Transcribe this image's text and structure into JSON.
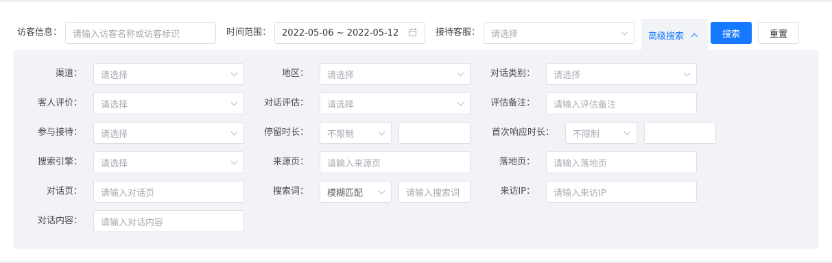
{
  "top": {
    "visitor_label": "访客信息：",
    "visitor_placeholder": "请输入访客名称或访客标识",
    "time_label": "时间范围：",
    "time_value": "2022-05-06 ~ 2022-05-12",
    "agent_label": "接待客服：",
    "agent_placeholder": "请选择",
    "advanced_label": "高级搜索",
    "search_button": "搜索",
    "reset_button": "重置"
  },
  "advanced": {
    "channel_label": "渠道：",
    "channel_placeholder": "请选择",
    "region_label": "地区：",
    "region_placeholder": "请选择",
    "category_label": "对话类别：",
    "category_placeholder": "请选择",
    "rating_label": "客人评价：",
    "rating_placeholder": "请选择",
    "evaluation_label": "对话评估：",
    "evaluation_placeholder": "请选择",
    "note_label": "评估备注：",
    "note_placeholder": "请输入评估备注",
    "participant_label": "参与接待：",
    "participant_placeholder": "请选择",
    "stay_label": "停留时长：",
    "stay_select": "不限制",
    "first_response_label": "首次响应时长：",
    "first_response_select": "不限制",
    "engine_label": "搜索引擎：",
    "engine_placeholder": "请选择",
    "source_label": "来源页：",
    "source_placeholder": "请输入来源页",
    "landing_label": "落地页：",
    "landing_placeholder": "请输入落地页",
    "dialog_page_label": "对话页：",
    "dialog_page_placeholder": "请输入对话页",
    "keyword_label": "搜索词：",
    "keyword_mode": "模糊匹配",
    "keyword_placeholder": "请输入搜索词",
    "ip_label": "来访IP：",
    "ip_placeholder": "请输入来访IP",
    "content_label": "对话内容：",
    "content_placeholder": "请输入对话内容"
  },
  "colors": {
    "primary": "#1677ff",
    "panel_bg": "#f2f3f7",
    "border": "#dcdfe6",
    "placeholder": "#a8abb2"
  }
}
